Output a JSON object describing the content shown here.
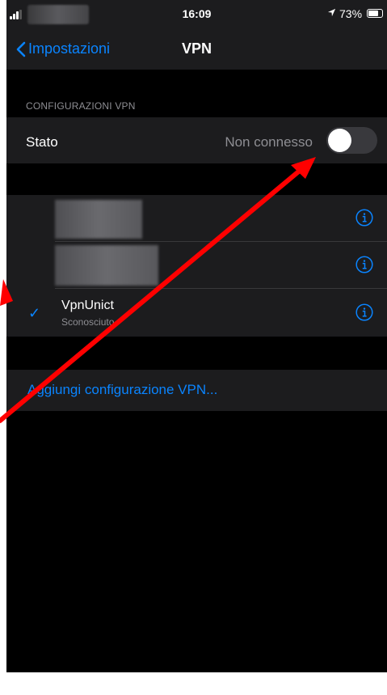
{
  "status_bar": {
    "time": "16:09",
    "battery_percent": "73%",
    "battery_level": 0.73,
    "location_icon": "location-arrow-icon",
    "signal_icon": "signal-bars-icon"
  },
  "nav": {
    "back_label": "Impostazioni",
    "title": "VPN"
  },
  "section": {
    "header": "CONFIGURAZIONI VPN",
    "status_label": "Stato",
    "status_value": "Non connesso",
    "toggle_on": false
  },
  "vpn_list": [
    {
      "name": "VpnUnict",
      "subtitle": "Sconosciuto",
      "selected": true
    }
  ],
  "add_label": "Aggiungi configurazione VPN...",
  "colors": {
    "accent": "#0a84ff",
    "annotation_arrow": "#ff0000",
    "background": "#000000",
    "cell": "#1c1c1e"
  }
}
